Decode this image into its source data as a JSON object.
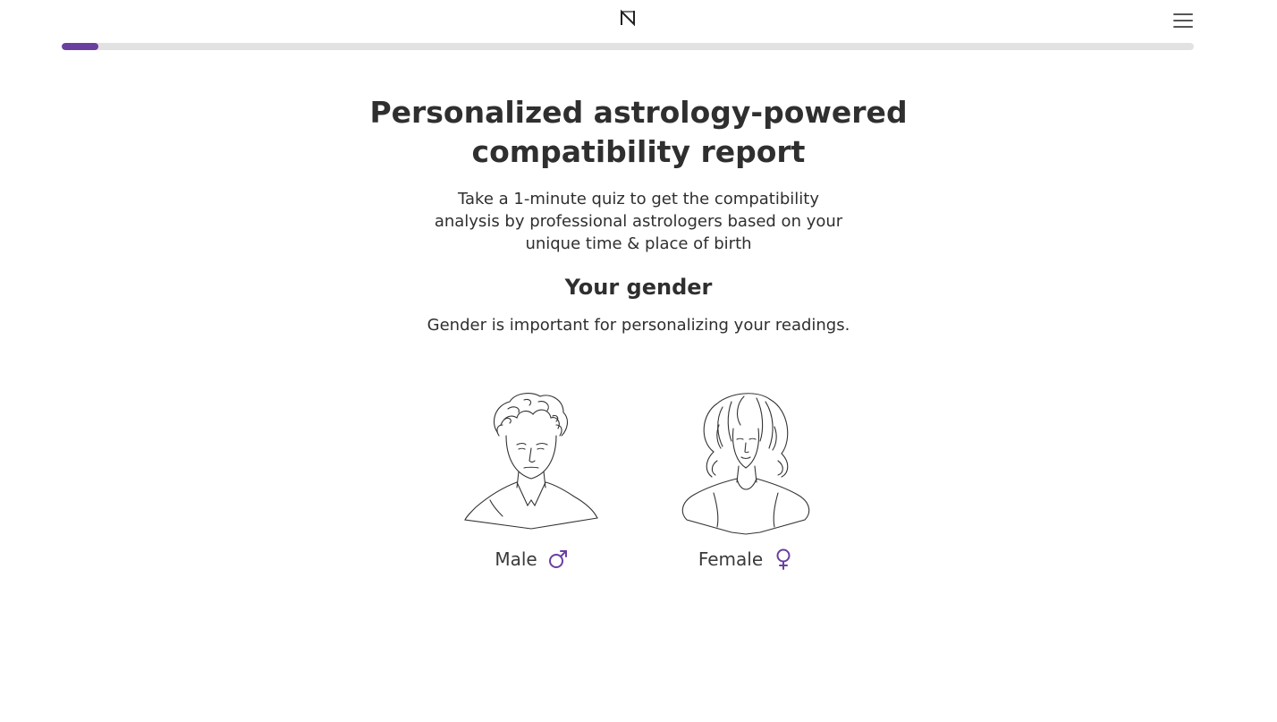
{
  "header": {
    "logo_icon": "n-logo-icon",
    "menu_icon": "hamburger-menu-icon"
  },
  "progress": {
    "value_percent": 3.2,
    "color": "#6b3fa0"
  },
  "main": {
    "title": "Personalized astrology-powered compatibility report",
    "subtitle": "Take a 1-minute quiz to get the compatibility analysis by professional astrologers based on your unique time & place of birth",
    "section_title": "Your gender",
    "section_desc": "Gender is important for personalizing your readings."
  },
  "gender_options": [
    {
      "label": "Male",
      "icon": "male-symbol-icon",
      "illustration": "male-portrait-illustration"
    },
    {
      "label": "Female",
      "icon": "female-symbol-icon",
      "illustration": "female-portrait-illustration"
    }
  ],
  "colors": {
    "accent": "#6b3fa0",
    "text": "#2f2f2f",
    "track": "#e2e2e2"
  }
}
